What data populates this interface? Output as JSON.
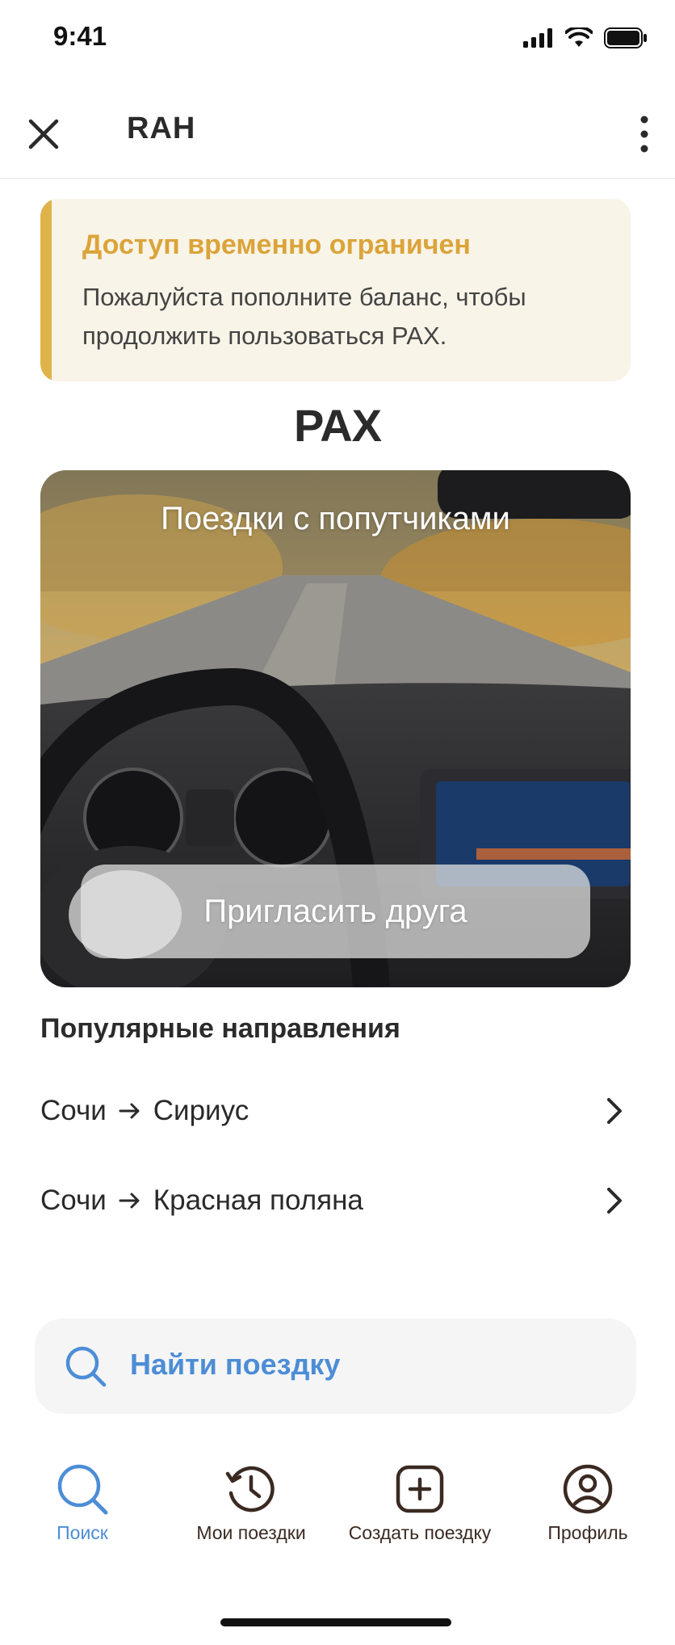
{
  "status_bar": {
    "time": "9:41"
  },
  "header": {
    "title": "RAH"
  },
  "alert": {
    "title": "Доступ временно ограничен",
    "text": "Пожалуйста пополните баланс, чтобы продолжить пользоваться PAX."
  },
  "brand": {
    "logo_text": "PAX"
  },
  "hero": {
    "title": "Поездки с попутчиками",
    "invite_label": "Пригласить друга"
  },
  "popular": {
    "title": "Популярные направления",
    "routes": [
      {
        "from": "Сочи",
        "to": "Сириус"
      },
      {
        "from": "Сочи",
        "to": "Красная поляна"
      }
    ]
  },
  "search": {
    "label": "Найти поездку"
  },
  "tabs": [
    {
      "label": "Поиск",
      "icon": "search-icon",
      "active": true
    },
    {
      "label": "Мои поездки",
      "icon": "history-icon",
      "active": false
    },
    {
      "label": "Создать поездку",
      "icon": "plus-square-icon",
      "active": false
    },
    {
      "label": "Профиль",
      "icon": "profile-icon",
      "active": false
    }
  ],
  "colors": {
    "accent": "#4c8dd6",
    "warning": "#dba43a",
    "warning_bg": "#f9f4e8",
    "text_dark": "#2b2b2b"
  }
}
